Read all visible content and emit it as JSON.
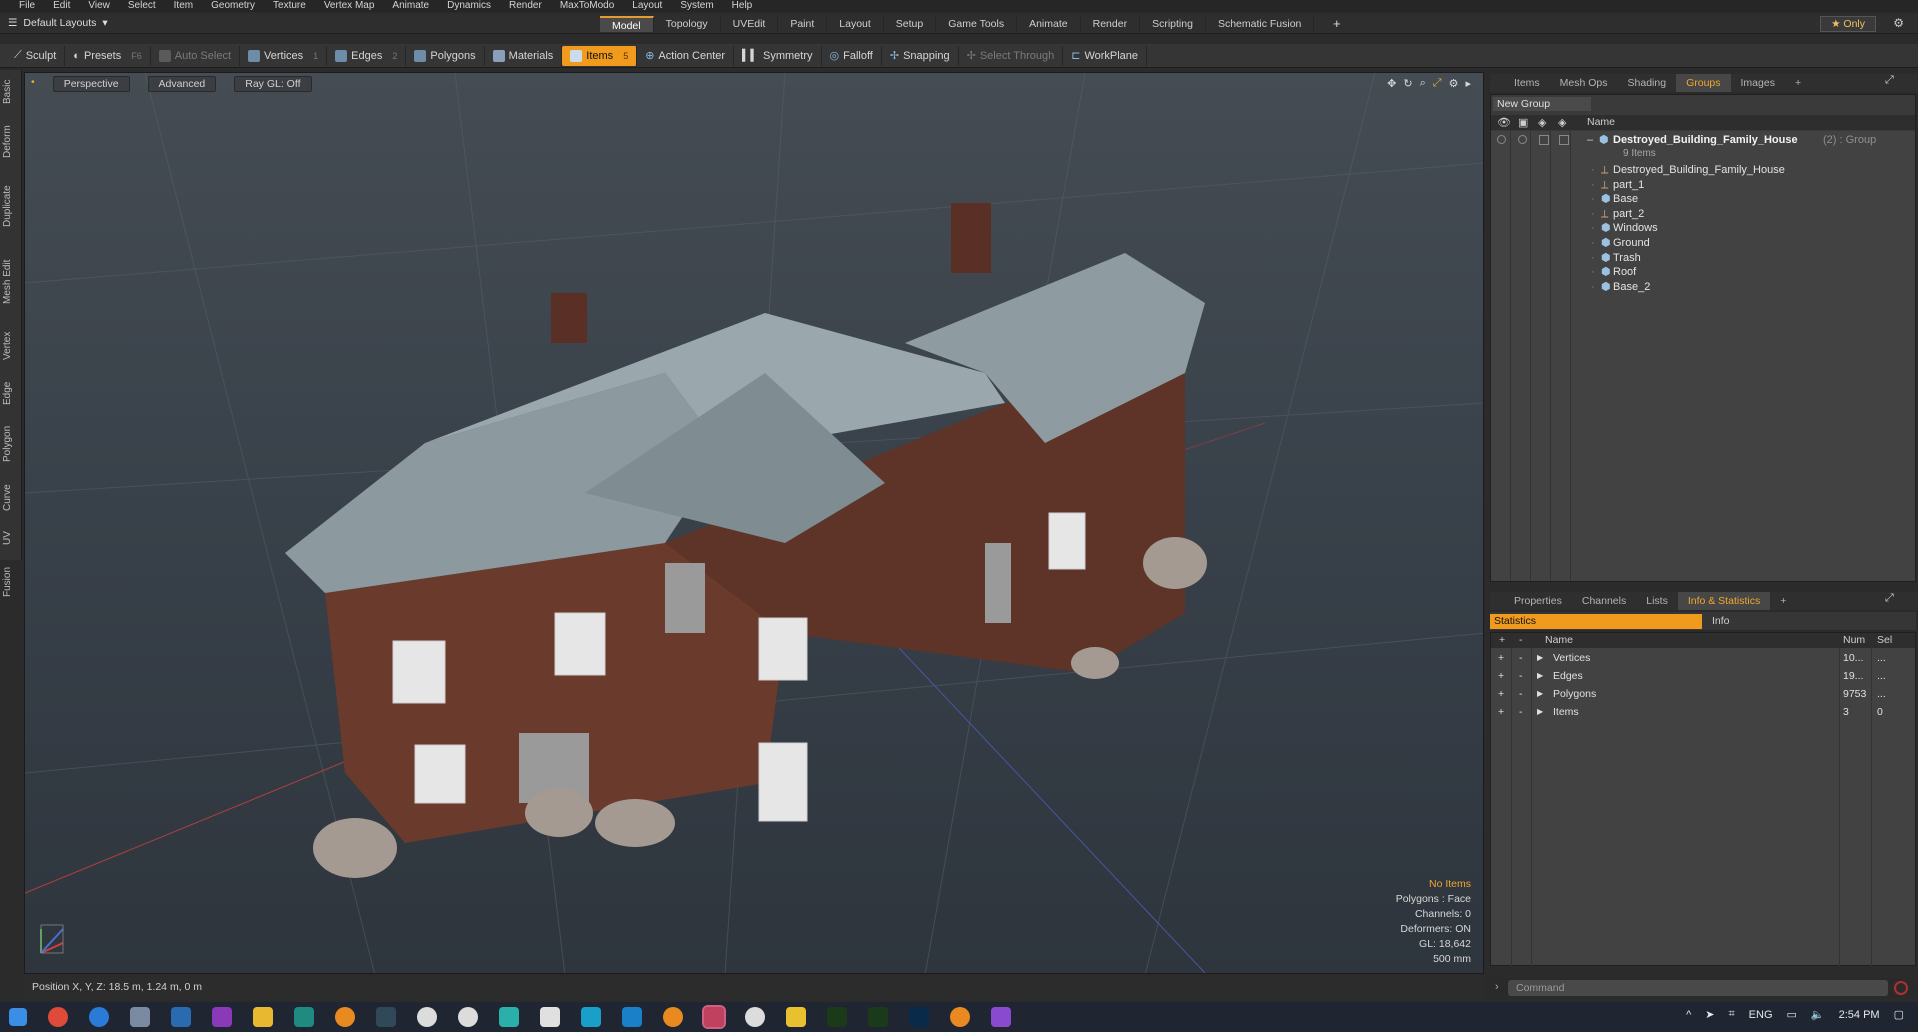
{
  "menu": [
    "File",
    "Edit",
    "View",
    "Select",
    "Item",
    "Geometry",
    "Texture",
    "Vertex Map",
    "Animate",
    "Dynamics",
    "Render",
    "MaxToModo",
    "Layout",
    "System",
    "Help"
  ],
  "layout_dropdown": "Default Layouts",
  "layout_tabs": [
    "Model",
    "Topology",
    "UVEdit",
    "Paint",
    "Layout",
    "Setup",
    "Game Tools",
    "Animate",
    "Render",
    "Scripting",
    "Schematic Fusion"
  ],
  "active_layout_tab": "Model",
  "only_button": "Only",
  "toolbar": {
    "sculpt": "Sculpt",
    "presets": "Presets",
    "presets_key": "F6",
    "auto_select": "Auto Select",
    "vertices": "Vertices",
    "vertices_key": "1",
    "edges": "Edges",
    "edges_key": "2",
    "polygons": "Polygons",
    "materials": "Materials",
    "items": "Items",
    "items_key": "5",
    "action_center": "Action Center",
    "symmetry": "Symmetry",
    "falloff": "Falloff",
    "snapping": "Snapping",
    "select_through": "Select Through",
    "workplane": "WorkPlane"
  },
  "left_tabs": [
    "Basic",
    "Deform",
    "Duplicate",
    "Mesh Edit",
    "Vertex",
    "Edge",
    "Polygon",
    "Curve",
    "UV",
    "Fusion"
  ],
  "viewport": {
    "perspective": "Perspective",
    "advanced": "Advanced",
    "raygl": "Ray GL: Off",
    "info": {
      "no_items": "No Items",
      "polygons": "Polygons : Face",
      "channels": "Channels: 0",
      "deformers": "Deformers: ON",
      "gl": "GL: 18,642",
      "scale": "500 mm"
    }
  },
  "status_position": "Position X, Y, Z:   18.5 m, 1.24 m, 0 m",
  "right_tabs": [
    "Items",
    "Mesh Ops",
    "Shading",
    "Groups",
    "Images"
  ],
  "active_right_tab": "Groups",
  "groups": {
    "new_group": "New Group",
    "col_name": "Name",
    "root_name": "Destroyed_Building_Family_House",
    "root_suffix": "(2) : Group",
    "root_count": "9 Items",
    "children": [
      "Destroyed_Building_Family_House",
      "part_1",
      "Base",
      "part_2",
      "Windows",
      "Ground",
      "Trash",
      "Roof",
      "Base_2"
    ]
  },
  "info_tabs": [
    "Properties",
    "Channels",
    "Lists",
    "Info & Statistics"
  ],
  "active_info_tab": "Info & Statistics",
  "stats": {
    "statistics_label": "Statistics",
    "info_label": "Info",
    "col_name": "Name",
    "col_num": "Num",
    "col_sel": "Sel",
    "rows": [
      {
        "name": "Vertices",
        "num": "10...",
        "sel": "..."
      },
      {
        "name": "Edges",
        "num": "19...",
        "sel": "..."
      },
      {
        "name": "Polygons",
        "num": "9753",
        "sel": "..."
      },
      {
        "name": "Items",
        "num": "3",
        "sel": "0"
      }
    ]
  },
  "command_placeholder": "Command",
  "clock": "2:54 PM",
  "lang": "ENG",
  "colors": {
    "accent": "#f09a1e",
    "viewport": "#3a424a"
  }
}
